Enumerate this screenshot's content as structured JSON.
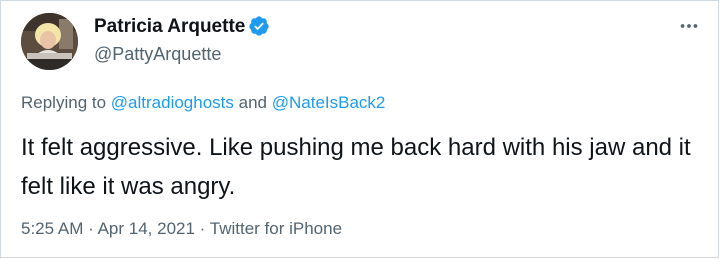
{
  "author": {
    "name": "Patricia Arquette",
    "handle": "@PattyArquette",
    "verified": true
  },
  "reply": {
    "prefix": "Replying to",
    "mention_1": "@altradioghosts",
    "conjunction": "and",
    "mention_2": "@NateIsBack2"
  },
  "tweet": {
    "text": "It felt aggressive. Like pushing me back hard with his jaw and it felt like it was angry."
  },
  "meta": {
    "time": "5:25 AM",
    "separator_1": "·",
    "date": "Apr 14, 2021",
    "separator_2": "·",
    "source": "Twitter for iPhone"
  },
  "icons": {
    "verified": "verified-badge-icon",
    "more": "more-options-icon"
  },
  "colors": {
    "link": "#1d9bf0",
    "secondary_text": "#536471",
    "primary_text": "#0f1419",
    "border": "#cfd9de"
  }
}
